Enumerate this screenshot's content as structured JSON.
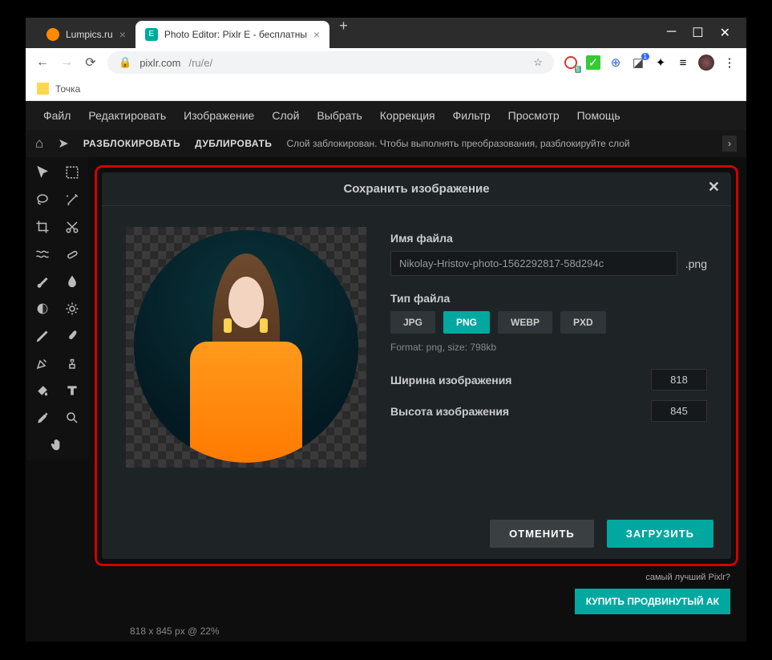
{
  "browser": {
    "tabs": [
      {
        "title": "Lumpics.ru",
        "favi_color": "#ff8a00",
        "active": false
      },
      {
        "title": "Photo Editor: Pixlr E - бесплатны",
        "favi_color": "#00a8a0",
        "active": true
      }
    ],
    "url_host": "pixlr.com",
    "url_path": "/ru/e/",
    "bookmark": "Точка"
  },
  "menubar": [
    "Файл",
    "Редактировать",
    "Изображение",
    "Слой",
    "Выбрать",
    "Коррекция",
    "Фильтр",
    "Просмотр",
    "Помощь"
  ],
  "subbar": {
    "home_icon": "home-icon",
    "pointer_icon": "pointer-icon",
    "unlock": "РАЗБЛОКИРОВАТЬ",
    "duplicate": "ДУБЛИРОВАТЬ",
    "msg": "Слой заблокирован. Чтобы выполнять преобразования, разблокируйте слой"
  },
  "tools": [
    "pointer",
    "marquee",
    "lasso",
    "magic-wand",
    "crop",
    "cut",
    "wave",
    "eraser-bg",
    "brush",
    "drop",
    "contrast",
    "gear",
    "pencil",
    "paintbrush",
    "pencil-thin",
    "stamp",
    "bucket",
    "text",
    "dropper",
    "zoom",
    "hand"
  ],
  "modal": {
    "title": "Сохранить изображение",
    "file_label": "Имя файла",
    "file_name": "Nikolay-Hristov-photo-1562292817-58d294c",
    "ext": ".png",
    "type_label": "Тип файла",
    "types": [
      "JPG",
      "PNG",
      "WEBP",
      "PXD"
    ],
    "type_selected": "PNG",
    "meta": "Format: png, size: 798kb",
    "width_label": "Ширина изображения",
    "height_label": "Высота изображения",
    "width": "818",
    "height": "845",
    "cancel": "ОТМЕНИТЬ",
    "download": "ЗАГРУЗИТЬ"
  },
  "promo": {
    "line": "самый лучший Pixlr?",
    "buy": "КУПИТЬ ПРОДВИНУТЫЙ АК"
  },
  "status": "818 x 845 px @ 22%"
}
